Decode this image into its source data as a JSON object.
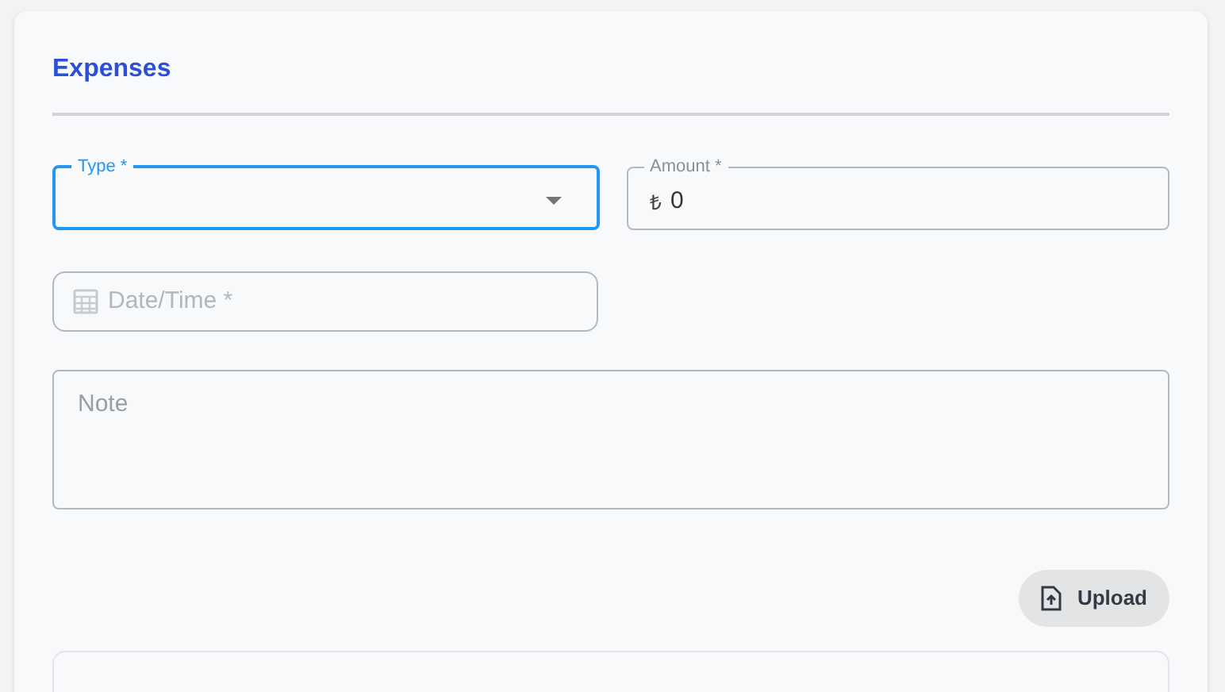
{
  "title": "Expenses",
  "fields": [
    {
      "kind": "select",
      "label": "Type *",
      "focused": true
    },
    {
      "kind": "amount",
      "label": "Amount *",
      "prefix": "₺",
      "value": "0",
      "focused": false
    }
  ],
  "date_field": {
    "placeholder": "Date/Time *"
  },
  "note_field": {
    "placeholder": "Note"
  },
  "upload_button": {
    "label": "Upload"
  }
}
